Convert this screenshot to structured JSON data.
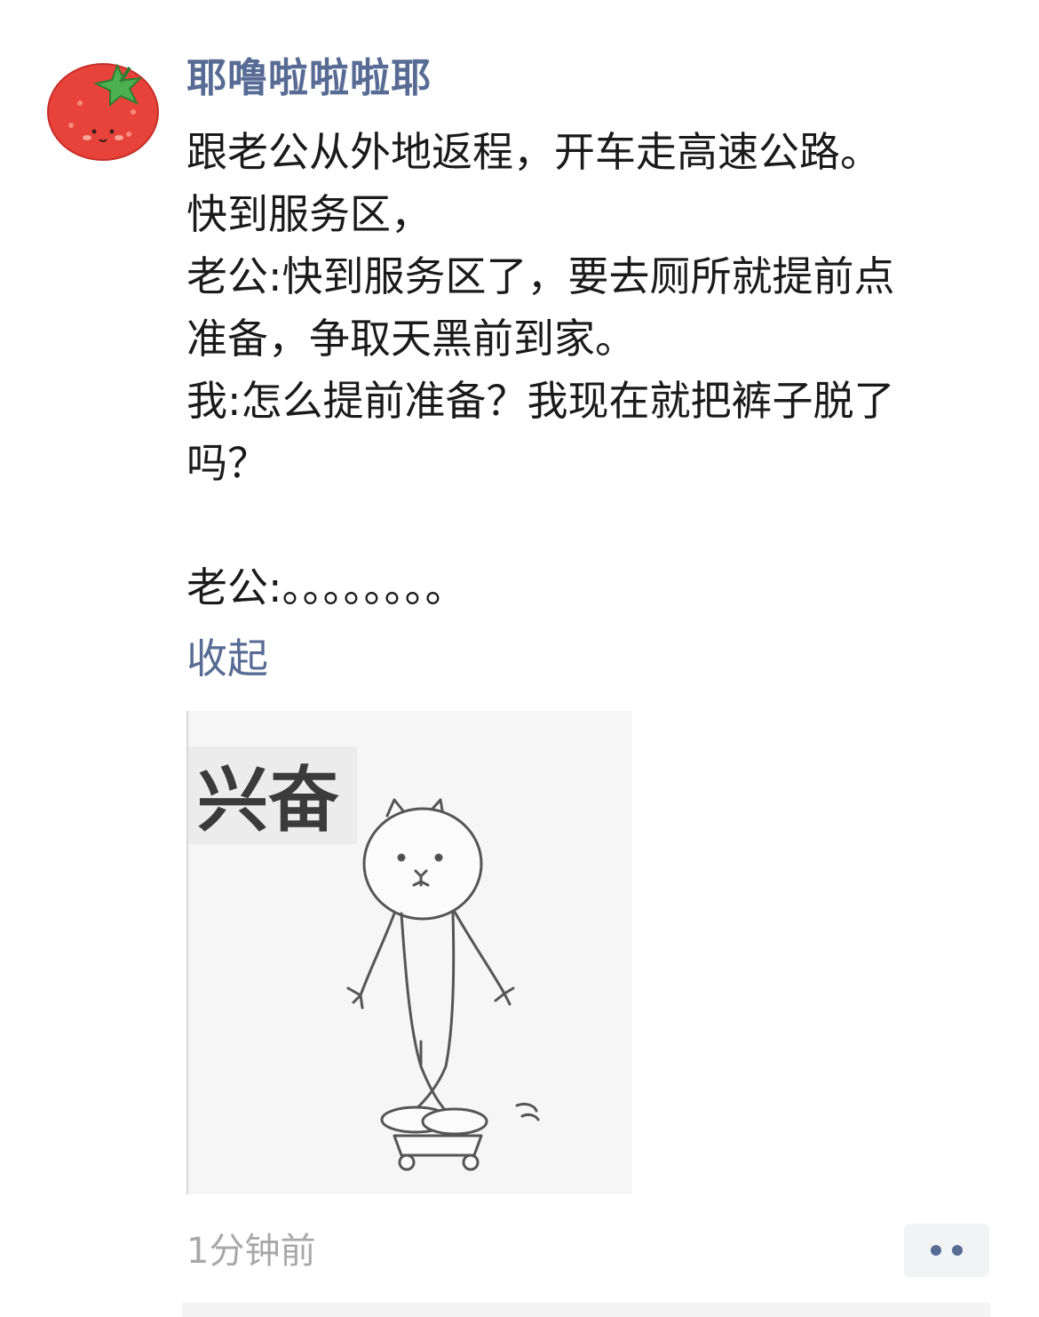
{
  "post": {
    "username": "耶噜啦啦啦耶",
    "content_lines": [
      "跟老公从外地返程，开车走高速公路。",
      "快到服务区，",
      "老公:快到服务区了，要去厕所就提前点",
      "准备，争取天黑前到家。",
      "我:怎么提前准备？我现在就把裤子脱了",
      "吗？",
      "",
      "老公:。。。。。。。。"
    ],
    "collapse_label": "收起",
    "meme_caption": "兴奋",
    "timestamp": "1分钟前",
    "more_button_icon": "more-dots-icon",
    "avatar_icon": "tomato-icon"
  },
  "colors": {
    "link_blue": "#576b95",
    "text": "#1a1a1a",
    "timestamp_gray": "#a8a8a8"
  }
}
